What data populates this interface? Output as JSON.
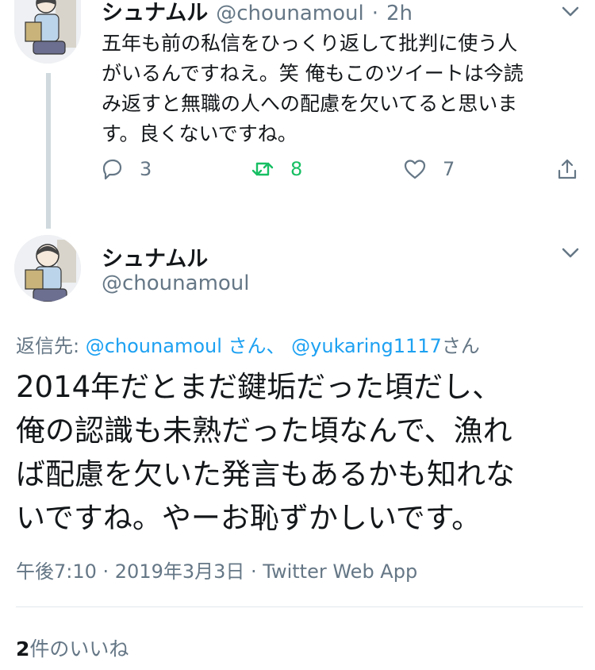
{
  "tweet1": {
    "display_name": "シュナムル",
    "handle": "@chounamoul",
    "separator": "·",
    "time": "2h",
    "text_lines": [
      "五年も前の私信をひっくり返して批判に使う人",
      "がいるんですねえ。笑 俺もこのツイートは今読",
      "み返すと無職の人への配慮を欠いてると思いま",
      "す。良くないですね。"
    ],
    "reply_count": "3",
    "retweet_count": "8",
    "like_count": "7",
    "icons": [
      "reply-icon",
      "retweet-icon",
      "like-icon",
      "share-icon",
      "chevron-down-icon"
    ],
    "retweet_color": "#17bf63"
  },
  "tweet2": {
    "display_name": "シュナムル",
    "handle": "@chounamoul",
    "reply_prefix": "返信先: ",
    "mention1": "@chounamoul",
    "suffix1": " さん、 ",
    "mention2": "@yukaring1117",
    "suffix2": "さん",
    "text_lines": [
      "2014年だとまだ鍵垢だった頃だし、",
      "俺の認識も未熟だった頃なんで、漁れ",
      "ば配慮を欠いた発言もあるかも知れな",
      "いですね。やーお恥ずかしいです。"
    ],
    "timestamp": "午後7:10 · 2019年3月3日 · Twitter Web App",
    "likes_count": "2",
    "likes_unit": "件",
    "likes_label": "のいいね"
  },
  "colors": {
    "link": "#1da1f2",
    "secondary_text": "#657786",
    "primary_text": "#14171a",
    "thread_line": "#cfd9de"
  }
}
